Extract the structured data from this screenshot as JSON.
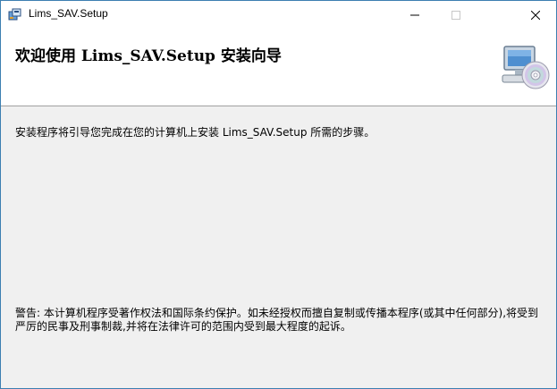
{
  "window": {
    "title": "Lims_SAV.Setup",
    "minimize_icon": "minimize-icon",
    "maximize_icon": "maximize-icon",
    "close_icon": "close-icon",
    "app_icon": "installer-package-icon"
  },
  "header": {
    "title": "欢迎使用 Lims_SAV.Setup 安装向导",
    "banner_icon": "computer-cd-icon"
  },
  "body": {
    "description": "安装程序将引导您完成在您的计算机上安装 Lims_SAV.Setup 所需的步骤。",
    "warning": "警告: 本计算机程序受著作权法和国际条约保护。如未经授权而擅自复制或传播本程序(或其中任何部分),将受到严厉的民事及刑事制裁,并将在法律许可的范围内受到最大程度的起诉。"
  },
  "colors": {
    "window_border": "#3c7fb1",
    "background": "#f0f0f0",
    "header_background": "#ffffff"
  }
}
